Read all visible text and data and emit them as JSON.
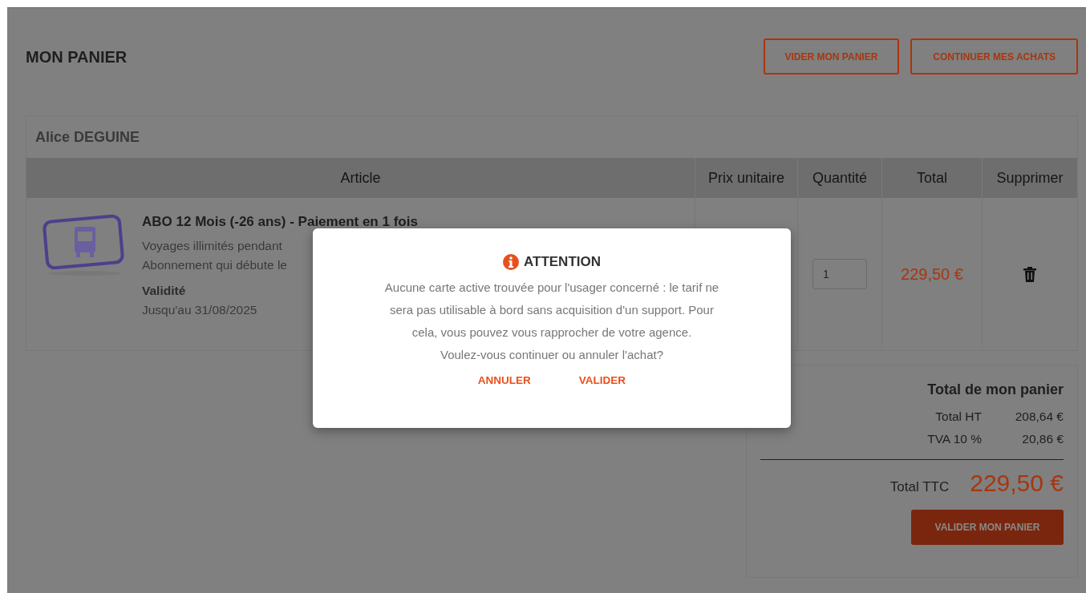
{
  "page": {
    "title": "MON PANIER",
    "actions": [
      "VIDER MON PANIER",
      "CONTINUER MES ACHATS"
    ]
  },
  "cart": {
    "customer": "Alice DEGUINE",
    "columns": [
      "Article",
      "Prix unitaire",
      "Quantité",
      "Total",
      "Supprimer"
    ],
    "items": [
      {
        "name": "ABO 12 Mois (-26 ans) - Paiement en 1 fois",
        "description": [
          "Voyages illimités pendant",
          "Abonnement qui débute le"
        ],
        "validity_label": "Validité",
        "validity": "Jusqu'au 31/08/2025",
        "quantity": "1",
        "total": "229,50 €"
      }
    ]
  },
  "summary": {
    "title": "Total de mon panier",
    "lines": [
      {
        "label": "Total HT",
        "value": "208,64 €"
      },
      {
        "label": "TVA 10 %",
        "value": "20,86 €"
      }
    ],
    "total_label": "Total TTC",
    "total": "229,50 €",
    "button": "VALIDER MON PANIER"
  },
  "dialog": {
    "title": "ATTENTION",
    "message": [
      "Aucune carte active trouvée pour l'usager concerné : le tarif ne",
      "sera pas utilisable à bord sans acquisition d'un support. Pour",
      "cela, vous pouvez vous rapprocher de votre agence.",
      "Voulez-vous continuer ou annuler l'achat?"
    ],
    "buttons": [
      "ANNULER",
      "VALIDER"
    ]
  }
}
